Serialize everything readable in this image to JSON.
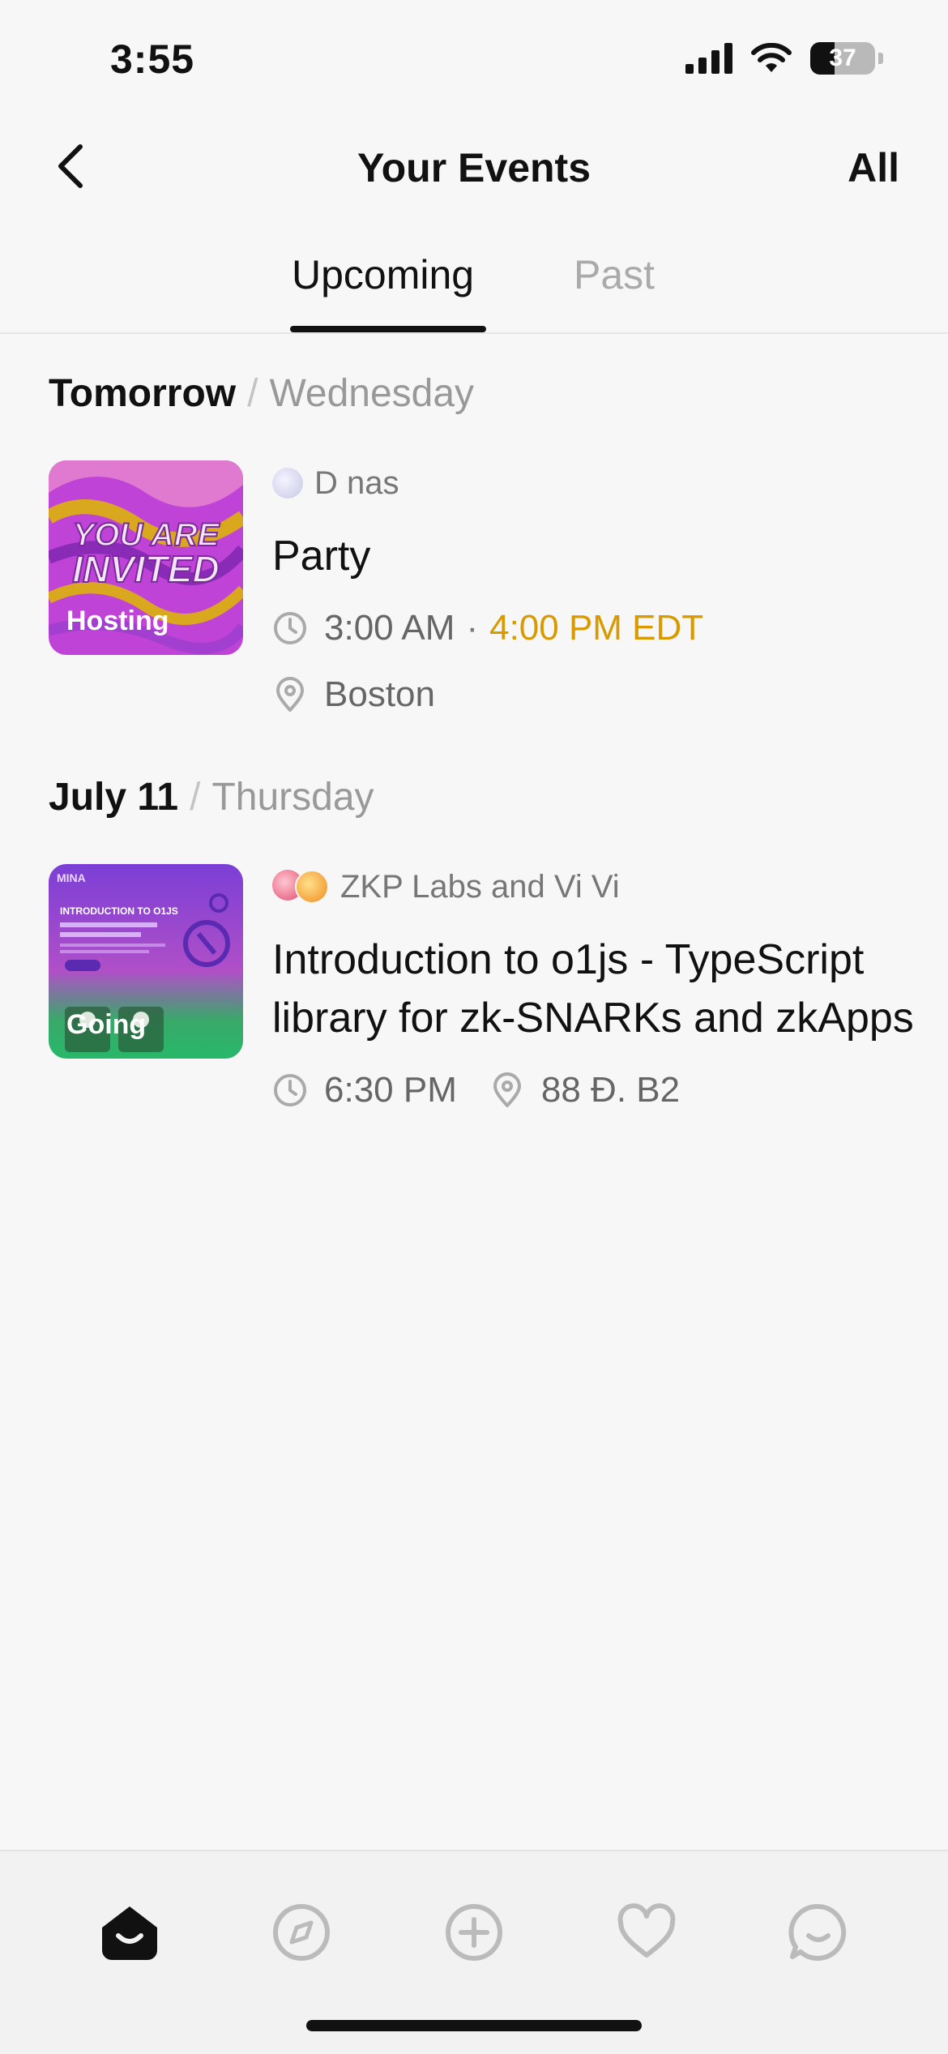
{
  "status_bar": {
    "time": "3:55",
    "battery_level": "37",
    "battery_fraction": 0.37
  },
  "header": {
    "title": "Your Events",
    "right_action": "All"
  },
  "tabs": [
    {
      "label": "Upcoming",
      "active": true
    },
    {
      "label": "Past",
      "active": false
    }
  ],
  "sections": [
    {
      "date": "Tomorrow",
      "weekday": "Wednesday",
      "event": {
        "badge": "Hosting",
        "host": "D nas",
        "title": "Party",
        "time_start": "3:00 AM",
        "time_separator": "·",
        "time_end": "4:00 PM EDT",
        "location": "Boston",
        "thumbnail_text_1": "YOU ARE",
        "thumbnail_text_2": "INVITED"
      }
    },
    {
      "date": "July 11",
      "weekday": "Thursday",
      "event": {
        "badge": "Going",
        "host": "ZKP Labs and Vi Vi",
        "title": "Introduction to o1js - TypeScript library for zk-SNARKs and zkApps",
        "time": "6:30 PM",
        "location": "88 Đ. B2",
        "thumbnail_text_1": "MINA",
        "thumbnail_text_2": "INTRODUCTION TO O1JS"
      }
    }
  ],
  "bottom_nav": [
    {
      "icon": "home-icon",
      "active": true
    },
    {
      "icon": "compass-icon",
      "active": false
    },
    {
      "icon": "plus-circle-icon",
      "active": false
    },
    {
      "icon": "heart-icon",
      "active": false
    },
    {
      "icon": "chat-icon",
      "active": false
    }
  ],
  "colors": {
    "accent_time": "#d99a00",
    "muted_text": "#777777",
    "background": "#f7f7f7"
  }
}
